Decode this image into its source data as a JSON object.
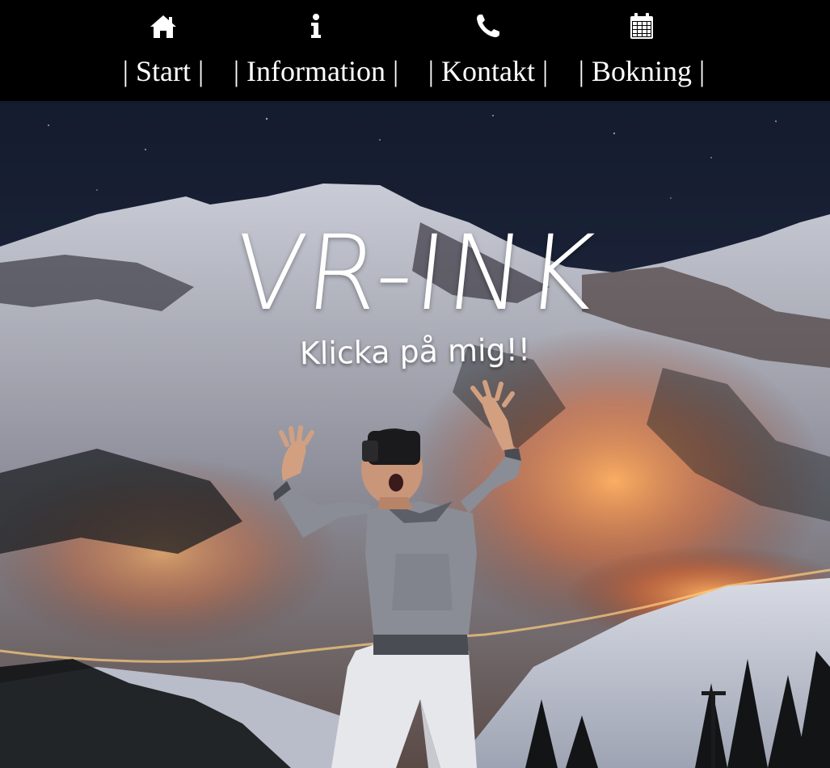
{
  "nav": {
    "items": [
      {
        "label": "| Start |",
        "icon": "home-icon"
      },
      {
        "label": "| Information |",
        "icon": "info-icon"
      },
      {
        "label": "| Kontakt |",
        "icon": "phone-icon"
      },
      {
        "label": "| Bokning |",
        "icon": "calendar-icon"
      }
    ],
    "background": "#000000",
    "text_color": "#ffffff"
  },
  "hero": {
    "title": "VR-INK",
    "cta": "Klicka på mig!!",
    "image": "person-with-vr-headset-in-front-of-snowy-mountain-night"
  }
}
